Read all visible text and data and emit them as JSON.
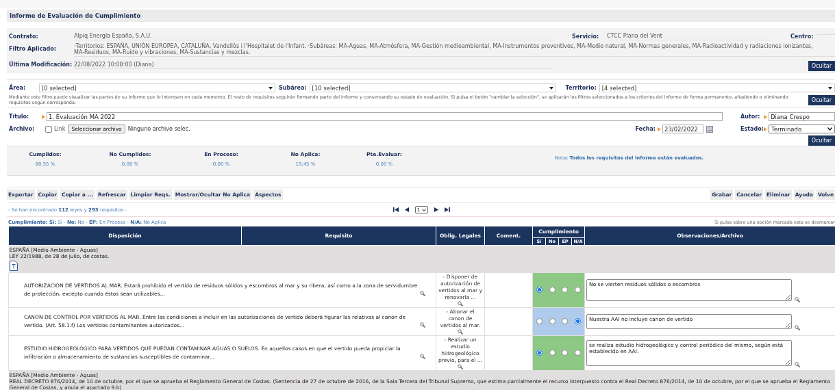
{
  "title": "Informe de Evaluación de Cumplimiento",
  "info": {
    "contrato": {
      "label": "Contrato:",
      "value": "Alpiq Energía España, S.A.U."
    },
    "servicio": {
      "label": "Servicio:",
      "value": "CTCC Plana del Vent"
    },
    "centro": {
      "label": "Centro:"
    },
    "filtro": {
      "label": "Filtro Aplicado:",
      "value": "·Territorios: ESPAÑA, UNIÓN EUROPEA, CATALUÑA, Vandellòs i l'Hospitalet de l'Infant. ·Subáreas: MA-Aguas, MA-Atmósfera, MA-Gestión medioambiental, MA-Instrumentos preventivos, MA-Medio natural, MA-Normas generales, MA-Radioactividad y radiaciones ionizantes, MA-Residuos, MA-Ruido y vibraciones, MA-Sustancias y mezclas."
    },
    "modificacion": {
      "label": "Última Modificación:",
      "value": "22/08/2022 10:08:00 (Diana)"
    },
    "hide_button": "Ocultar"
  },
  "filters": {
    "fields": [
      {
        "label": "Área:",
        "value": "[0 selected]"
      },
      {
        "label": "Subárea:",
        "value": "[10 selected]"
      },
      {
        "label": "Territorio:",
        "value": "[4 selected]"
      }
    ],
    "help": "Mediante este filtro puede visualizar las partes de su informe que le interesen en cada momento. El resto de requisitos seguirán formando parte del informe y conservando su estado de evaluación. Si pulsa el botón \"cambiar la selección\", se aplicarán los filtros seleccionados a los criterios del informe de forma permanente, añadiendo o eliminando requisitos según corresponda.",
    "hide_button": "Ocultar"
  },
  "form": {
    "titulo": {
      "label": "Título:",
      "value": "1. Evaluación MA 2022"
    },
    "autor": {
      "label": "Autor:",
      "value": "Diana Crespo"
    },
    "archivo": {
      "label": "Archivo:"
    },
    "link": {
      "label": "Link",
      "checked": false
    },
    "file_button": "Seleccionar archivo",
    "file_status": "Ninguno archivo selec.",
    "fecha": {
      "label": "Fecha:",
      "value": "23/02/2022"
    },
    "estado": {
      "label": "Estado:",
      "value": "Terminado"
    },
    "hide_button": "Ocultar"
  },
  "stats": {
    "items": [
      {
        "label": "Cumplidos:",
        "value": "80,55 %"
      },
      {
        "label": "No Cumplidos:",
        "value": "0,00 %"
      },
      {
        "label": "En Proceso:",
        "value": "0,00 %"
      },
      {
        "label": "No Aplica:",
        "value": "19,45 %"
      },
      {
        "label": "Pte.Evaluar:",
        "value": "0,00 %"
      }
    ],
    "note": "Nota**: Todos los requisitos del informe están evaluados.**"
  },
  "toolbar": {
    "left": [
      "Exportar",
      "Copiar",
      "Copiar a ...",
      "Refrescar",
      "Limpiar Reqs.",
      "Mostrar/Ocultar No Aplica",
      "Aspectos"
    ],
    "right": [
      "Grabar",
      "Cancelar",
      "Eliminar",
      "Ayuda",
      "Volve"
    ]
  },
  "results": "- Se han encontrado **112** leyes y **293** requisitos -",
  "pagination": {
    "page": "1"
  },
  "legend": "**Cumplimiento: Sí:** Sí - **No:** No - **EP:** En Proceso - **N/A:** No Aplica",
  "hint": "Si pulsa sobre una opción marcada esta se desmarcar",
  "table": {
    "columns": [
      "Disposición",
      "Requisito",
      "Oblig. Legales",
      "Coment.",
      "Cumplimiento",
      "Observaciones/Archivo"
    ],
    "compliance_columns": [
      "Sí",
      "No",
      "EP",
      "N/A"
    ],
    "groups": [
      {
        "lines": [
          "ESPAÑA [Medio Ambiente - Aguas]",
          "LEY 22/1988, de 28 de julio, de costas."
        ],
        "rows": [
          {
            "disposicion": "AUTORIZACIÓN DE VERTIDOS AL MAR. Estará prohibido el vertido de residuos sólidos y escombros al mar y su ribera, así como a la zona de servidumbre de protección, excepto cuando éstos sean utilizables...",
            "obligacion": "- Disponer de autorización de vertidos al mar y renovarla ...",
            "options": [
              {
                "selected": true
              },
              {
                "selected": false
              },
              {
                "selected": false
              },
              {
                "selected": false
              }
            ],
            "observaciones": "No se vierten residuos sólidos o escombros"
          },
          {
            "disposicion": "CANON DE CONTROL POR VERTIDOS AL MAR. Entre las condiciones a incluir en las autorizaciones de vertido deberá figurar las relativas al canon de vertido. (Art. 58.1.f) Los vertidos contaminantes autorizados...",
            "obligacion": "- Abonar el canon de vertidos al mar.",
            "options": [
              {
                "selected": false
              },
              {
                "selected": false
              },
              {
                "selected": false
              },
              {
                "selected": true
              }
            ],
            "observaciones": "Nuestra AAI no incluye canon de vertido"
          },
          {
            "disposicion": "ESTUDIO HIDROGEOLÓGICO PARA VERTIDOS QUE PUEDAN CONTAMINAR AGUAS O SUELOS. En aquellos casos en que el vertido pueda propiciar la infiltración o almacenamiento de sustancias susceptibles de contaminar...",
            "obligacion": "- Realizar un estudio hidrogeológico previo, para el ...",
            "options": [
              {
                "selected": true
              },
              {
                "selected": false
              },
              {
                "selected": false
              },
              {
                "selected": false
              }
            ],
            "observaciones": "se realiza estudio hidrogeológico y control periódico del mismo, según está establecido en AAI."
          }
        ]
      },
      {
        "lines": [
          "ESPAÑA [Medio Ambiente - Aguas]",
          "REAL DECRETO 876/2014, de 10 de octubre, por el que se aprueba el Reglamento General de Costas. (Sentencia de 27 de octubre de 2016, de la Sala Tercera del Tribunal Supremo, que estima parcialmente el recurso interpuesto contra el Real Decreto 876/2014, de 10 de octubre, por el que se aprueba el Reglamento General de Costas, y anula el apartado 9.b)"
        ]
      }
    ]
  }
}
